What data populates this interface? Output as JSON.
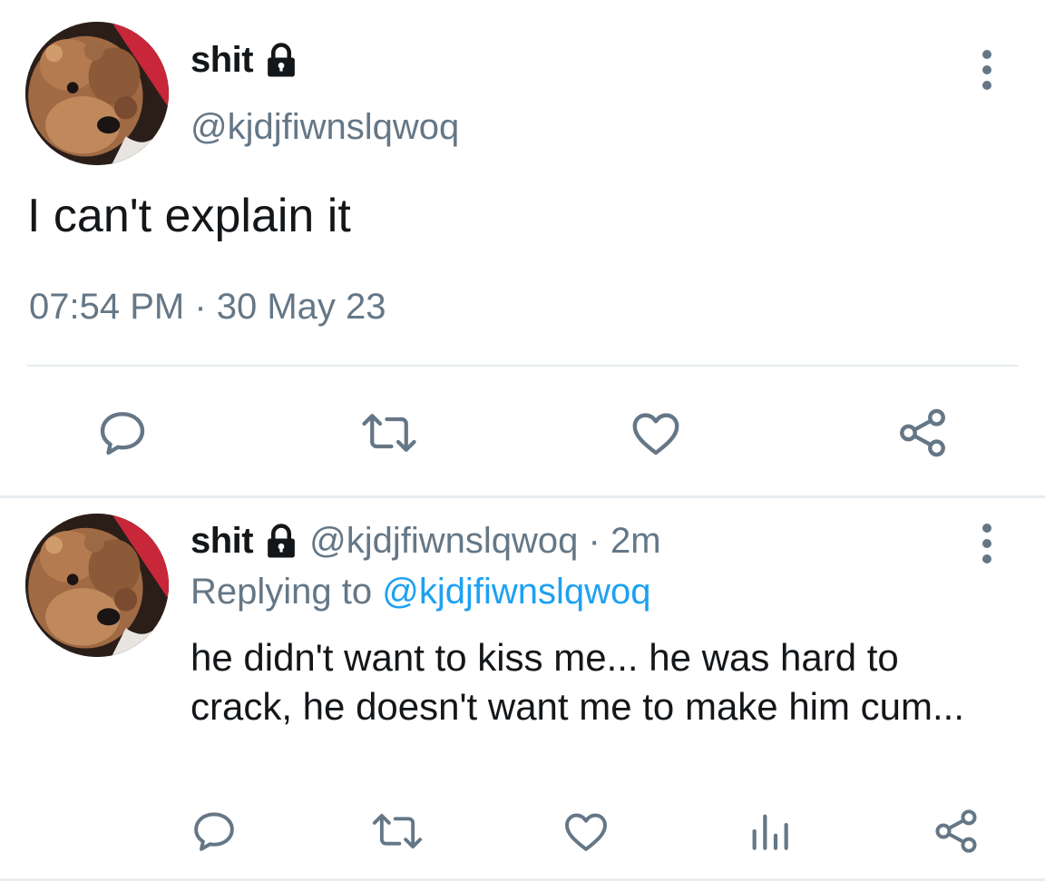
{
  "main_tweet": {
    "name": "shit",
    "handle": "@kjdjfiwnslqwoq",
    "text": "I can't explain it",
    "timestamp": "07:54 PM · 30 May 23",
    "icons": [
      "lock-icon",
      "more-vertical-icon",
      "reply-icon",
      "retweet-icon",
      "like-icon",
      "share-icon"
    ]
  },
  "reply_tweet": {
    "name": "shit",
    "handle_time": "@kjdjfiwnslqwoq · 2m",
    "replying_label": "Replying to",
    "replying_mention": "@kjdjfiwnslqwoq",
    "text": "he didn't want to kiss me... he was hard to crack, he doesn't want me to make him cum...",
    "icons": [
      "lock-icon",
      "more-vertical-icon",
      "reply-icon",
      "retweet-icon",
      "like-icon",
      "stats-icon",
      "share-icon"
    ]
  },
  "colors": {
    "text_primary": "#14171a",
    "text_secondary": "#657786",
    "accent": "#1da1f2",
    "divider": "#e6ecf0"
  }
}
